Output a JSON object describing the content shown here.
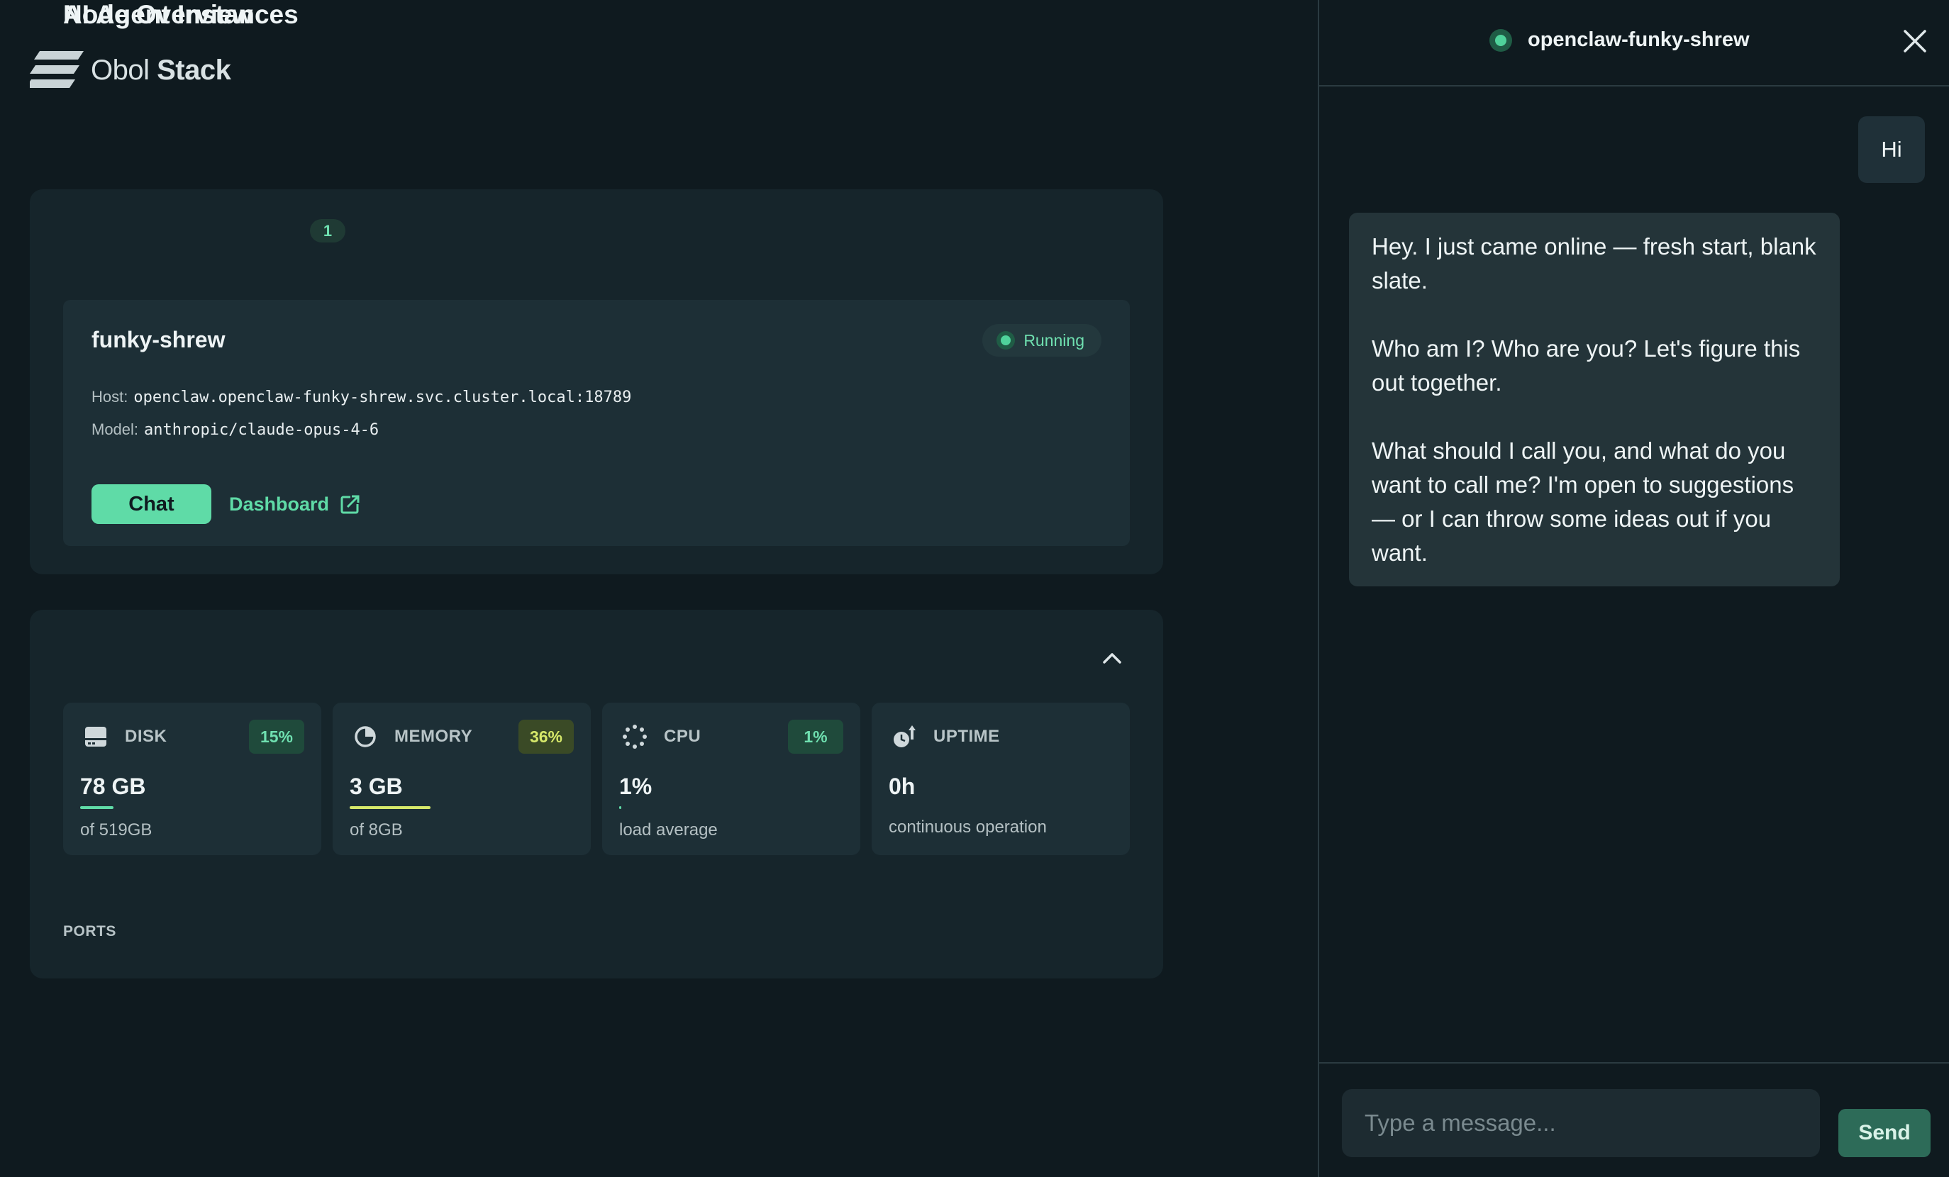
{
  "brand": {
    "name_light": "Obol",
    "name_bold": "Stack"
  },
  "instances": {
    "title": "AI Agent Instances",
    "count": "1",
    "items": [
      {
        "name": "funky-shrew",
        "status": "Running",
        "host_label": "Host:",
        "host": "openclaw.openclaw-funky-shrew.svc.cluster.local:18789",
        "model_label": "Model:",
        "model": "anthropic/claude-opus-4-6",
        "chat_label": "Chat",
        "dashboard_label": "Dashboard"
      }
    ]
  },
  "node_overview": {
    "title": "Node Overview",
    "metrics": {
      "disk": {
        "label": "DISK",
        "percent": "15%",
        "value": "78 GB",
        "sub": "of 519GB",
        "fill": 0.15,
        "icon": "disk-icon"
      },
      "memory": {
        "label": "MEMORY",
        "percent": "36%",
        "value": "3 GB",
        "sub": "of 8GB",
        "fill": 0.36,
        "icon": "memory-pie-icon"
      },
      "cpu": {
        "label": "CPU",
        "percent": "1%",
        "value": "1%",
        "sub": "load average",
        "fill": 0.01,
        "icon": "cpu-spinner-icon"
      },
      "uptime": {
        "label": "UPTIME",
        "value": "0h",
        "sub": "continuous operation",
        "icon": "uptime-clock-icon"
      }
    },
    "ports_label": "PORTS"
  },
  "chat": {
    "title": "openclaw-funky-shrew",
    "messages": [
      {
        "role": "user",
        "text": "Hi"
      },
      {
        "role": "assistant",
        "paragraphs": [
          "Hey. I just came online — fresh start, blank slate.",
          "Who am I? Who are you? Let's figure this out together.",
          "What should I call you, and what do you want to call me? I'm open to suggestions — or I can throw some ideas out if you want."
        ]
      }
    ],
    "input_placeholder": "Type a message...",
    "send_label": "Send"
  },
  "colors": {
    "background": "#0f1a1f",
    "card": "#16252b",
    "accent_green": "#5fdba7",
    "badge_yellow": "#d6e86a"
  }
}
